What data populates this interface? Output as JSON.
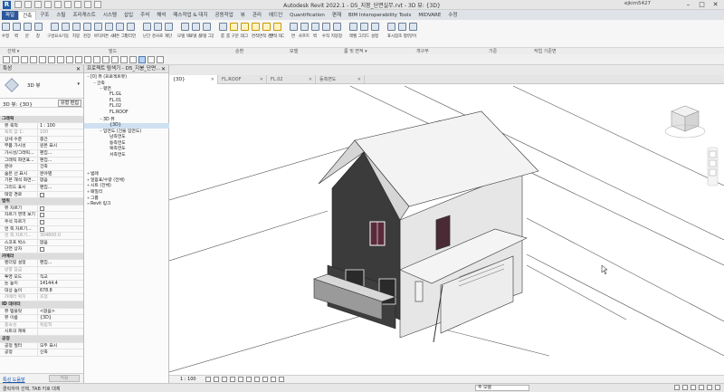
{
  "app": {
    "logo": "R",
    "title": "Autodesk Revit 2022.1 - D5_지붕_단면실무.rvt - 3D 뷰: {3D}",
    "user": "ejkim5427",
    "win_min": "–",
    "win_max": "□",
    "win_close": "✕"
  },
  "ribbon": {
    "tabs": [
      "파일",
      "건축",
      "구조",
      "스틸",
      "프리캐스트",
      "시스템",
      "삽입",
      "주석",
      "해석",
      "매스작업 & 대지",
      "공동작업",
      "뷰",
      "관리",
      "애드인",
      "Quantification",
      "편재",
      "BIM Interoperability Tools",
      "MIDVARE",
      "수정"
    ],
    "active_tab": "건축",
    "tools": [
      {
        "label": "수정",
        "icon": "modify-icon"
      },
      {
        "label": "벽",
        "icon": "wall-icon"
      },
      {
        "label": "문",
        "icon": "door-icon"
      },
      {
        "label": "창",
        "icon": "window-icon"
      },
      {
        "label": "구성요소",
        "icon": "component-icon"
      },
      {
        "label": "기둥",
        "icon": "column-icon"
      },
      {
        "label": "지붕",
        "icon": "roof-icon"
      },
      {
        "label": "천장",
        "icon": "ceiling-icon"
      },
      {
        "label": "바닥",
        "icon": "floor-icon"
      },
      {
        "label": "커튼 시스템",
        "icon": "curtain-system-icon"
      },
      {
        "label": "커튼 그리드",
        "icon": "curtain-grid-icon"
      },
      {
        "label": "멀리언",
        "icon": "mullion-icon"
      },
      {
        "label": "난간",
        "icon": "railing-icon"
      },
      {
        "label": "경사로",
        "icon": "ramp-icon"
      },
      {
        "label": "계단",
        "icon": "stair-icon"
      },
      {
        "label": "모델 텍스트",
        "icon": "model-text-icon"
      },
      {
        "label": "모델 선",
        "icon": "model-line-icon"
      },
      {
        "label": "모델 그룹",
        "icon": "model-group-icon"
      },
      {
        "label": "룸",
        "icon": "room-icon"
      },
      {
        "label": "룸 구분 기호",
        "icon": "room-separator-icon"
      },
      {
        "label": "태그",
        "icon": "tag-icon"
      },
      {
        "label": "면적",
        "icon": "area-icon"
      },
      {
        "label": "면적 경계",
        "icon": "area-boundary-icon"
      },
      {
        "label": "면적 태그",
        "icon": "area-tag-icon"
      },
      {
        "label": "면",
        "icon": "by-face-icon"
      },
      {
        "label": "샤프트",
        "icon": "shaft-icon"
      },
      {
        "label": "벽",
        "icon": "wall-opening-icon"
      },
      {
        "label": "수직",
        "icon": "vertical-icon"
      },
      {
        "label": "지붕창",
        "icon": "dormer-icon"
      },
      {
        "label": "레벨",
        "icon": "level-icon"
      },
      {
        "label": "그리드",
        "icon": "grid-icon"
      },
      {
        "label": "설정",
        "icon": "set-icon"
      },
      {
        "label": "표시",
        "icon": "show-icon"
      },
      {
        "label": "참조 평면",
        "icon": "ref-plane-icon"
      },
      {
        "label": "뷰어",
        "icon": "viewer-icon"
      }
    ],
    "groups": [
      "선택 ▾",
      "빌드",
      "순환",
      "모델",
      "룸 및 면적 ▾",
      "개구부",
      "기준",
      "작업 기준면"
    ]
  },
  "properties": {
    "header": "특성",
    "close": "✕",
    "type_name": "3D 뷰",
    "type_dd": "▾",
    "instance_label": "3D 뷰: {3D}",
    "edit_type": "유형 편집",
    "rows": [
      {
        "kind": "cat",
        "k": "그래픽"
      },
      {
        "k": "뷰 축척",
        "v": "1 : 100"
      },
      {
        "k": "축척 값  1:",
        "v": "100",
        "gray": true
      },
      {
        "k": "상세 수준",
        "v": "중간"
      },
      {
        "k": "부품 가시성",
        "v": "원본 표시"
      },
      {
        "k": "가시성/그래픽...",
        "v": "편집..."
      },
      {
        "k": "그래픽 화면표...",
        "v": "편집..."
      },
      {
        "k": "분야",
        "v": "건축"
      },
      {
        "k": "숨은 선 표시",
        "v": "분야별"
      },
      {
        "k": "기본 해석 화면...",
        "v": "없음"
      },
      {
        "k": "그리드 표시",
        "v": "편집..."
      },
      {
        "k": "태양 경로",
        "v": "",
        "chk": true
      },
      {
        "kind": "cat",
        "k": "범위"
      },
      {
        "k": "뷰 자르기",
        "v": "",
        "chk": true
      },
      {
        "k": "자르기 영역 보기",
        "v": "",
        "chk": true
      },
      {
        "k": "주석 자르기",
        "v": "",
        "chk": true
      },
      {
        "k": "먼 쪽 자르기...",
        "v": "",
        "chk": true
      },
      {
        "k": "먼 쪽 자르기...",
        "v": "304800.0",
        "gray": true
      },
      {
        "k": "스코프 박스",
        "v": "없음"
      },
      {
        "k": "단면 상자",
        "v": "",
        "chk": true
      },
      {
        "kind": "cat",
        "k": "카메라"
      },
      {
        "k": "렌더링 설정",
        "v": "편집..."
      },
      {
        "k": "방향 잠금",
        "v": "",
        "gray": true
      },
      {
        "k": "투영 모드",
        "v": "직교"
      },
      {
        "k": "눈 높이",
        "v": "14144.4"
      },
      {
        "k": "대상 높이",
        "v": "678.8"
      },
      {
        "k": "카메라 위치",
        "v": "조정",
        "gray": true
      },
      {
        "kind": "cat",
        "k": "ID 데이터"
      },
      {
        "k": "뷰 템플릿",
        "v": "<없음>"
      },
      {
        "k": "뷰 이름",
        "v": "{3D}"
      },
      {
        "k": "종속성",
        "v": "독립적",
        "gray": true
      },
      {
        "k": "시트의 제목",
        "v": ""
      },
      {
        "kind": "cat",
        "k": "공정"
      },
      {
        "k": "공정 필터",
        "v": "모두 표시"
      },
      {
        "k": "공정",
        "v": "신축"
      }
    ],
    "help_link": "특성 도움말",
    "apply": "적용"
  },
  "browser": {
    "header": "프로젝트 탐색기 - D5_지붕_단면...",
    "close": "✕",
    "nodes": [
      {
        "d": 0,
        "t": "[0] 뷰 (프로젝트뷰)",
        "tg": "−"
      },
      {
        "d": 1,
        "t": "건축",
        "tg": "−"
      },
      {
        "d": 2,
        "t": "평면",
        "tg": "−"
      },
      {
        "d": 3,
        "t": "FL.GL",
        "tg": ""
      },
      {
        "d": 3,
        "t": "FL.01",
        "tg": ""
      },
      {
        "d": 3,
        "t": "FL.02",
        "tg": ""
      },
      {
        "d": 3,
        "t": "FL.ROOF",
        "tg": ""
      },
      {
        "d": 2,
        "t": "3D 뷰",
        "tg": "−"
      },
      {
        "d": 3,
        "t": "{3D}",
        "tg": "",
        "sel": true
      },
      {
        "d": 2,
        "t": "입면도 (건물 입면도)",
        "tg": "−"
      },
      {
        "d": 3,
        "t": "남측면도",
        "tg": ""
      },
      {
        "d": 3,
        "t": "동측면도",
        "tg": ""
      },
      {
        "d": 3,
        "t": "북측면도",
        "tg": ""
      },
      {
        "d": 3,
        "t": "서측면도",
        "tg": ""
      },
      {
        "d": 0,
        "t": "",
        "tg": ""
      },
      {
        "d": 0,
        "t": "",
        "tg": ""
      },
      {
        "d": 0,
        "t": "범례",
        "tg": "+"
      },
      {
        "d": 0,
        "t": "일람표/수량 (전체)",
        "tg": "+"
      },
      {
        "d": 0,
        "t": "시트 (전체)",
        "tg": "+"
      },
      {
        "d": 0,
        "t": "패밀리",
        "tg": "+"
      },
      {
        "d": 0,
        "t": "그룹",
        "tg": "+"
      },
      {
        "d": 0,
        "t": "Revit 링크",
        "tg": "∞"
      }
    ]
  },
  "view_tabs": [
    {
      "label": "{3D}",
      "active": true
    },
    {
      "label": "FL.ROOF",
      "active": false
    },
    {
      "label": "FL.02",
      "active": false
    },
    {
      "label": "동측면도",
      "active": false
    }
  ],
  "view_control": {
    "scale": "1 : 100"
  },
  "status": {
    "text": "클릭하여 선택, TAB 키로 대체",
    "model": ":0",
    "main_model": "주 모델"
  },
  "colors": {
    "accent": "#2b579a",
    "wall_dark": "#3a3a3a",
    "wall_light": "#e4e4e4",
    "roof": "#f2f2f2",
    "window_glass": "#5a2a3a"
  }
}
